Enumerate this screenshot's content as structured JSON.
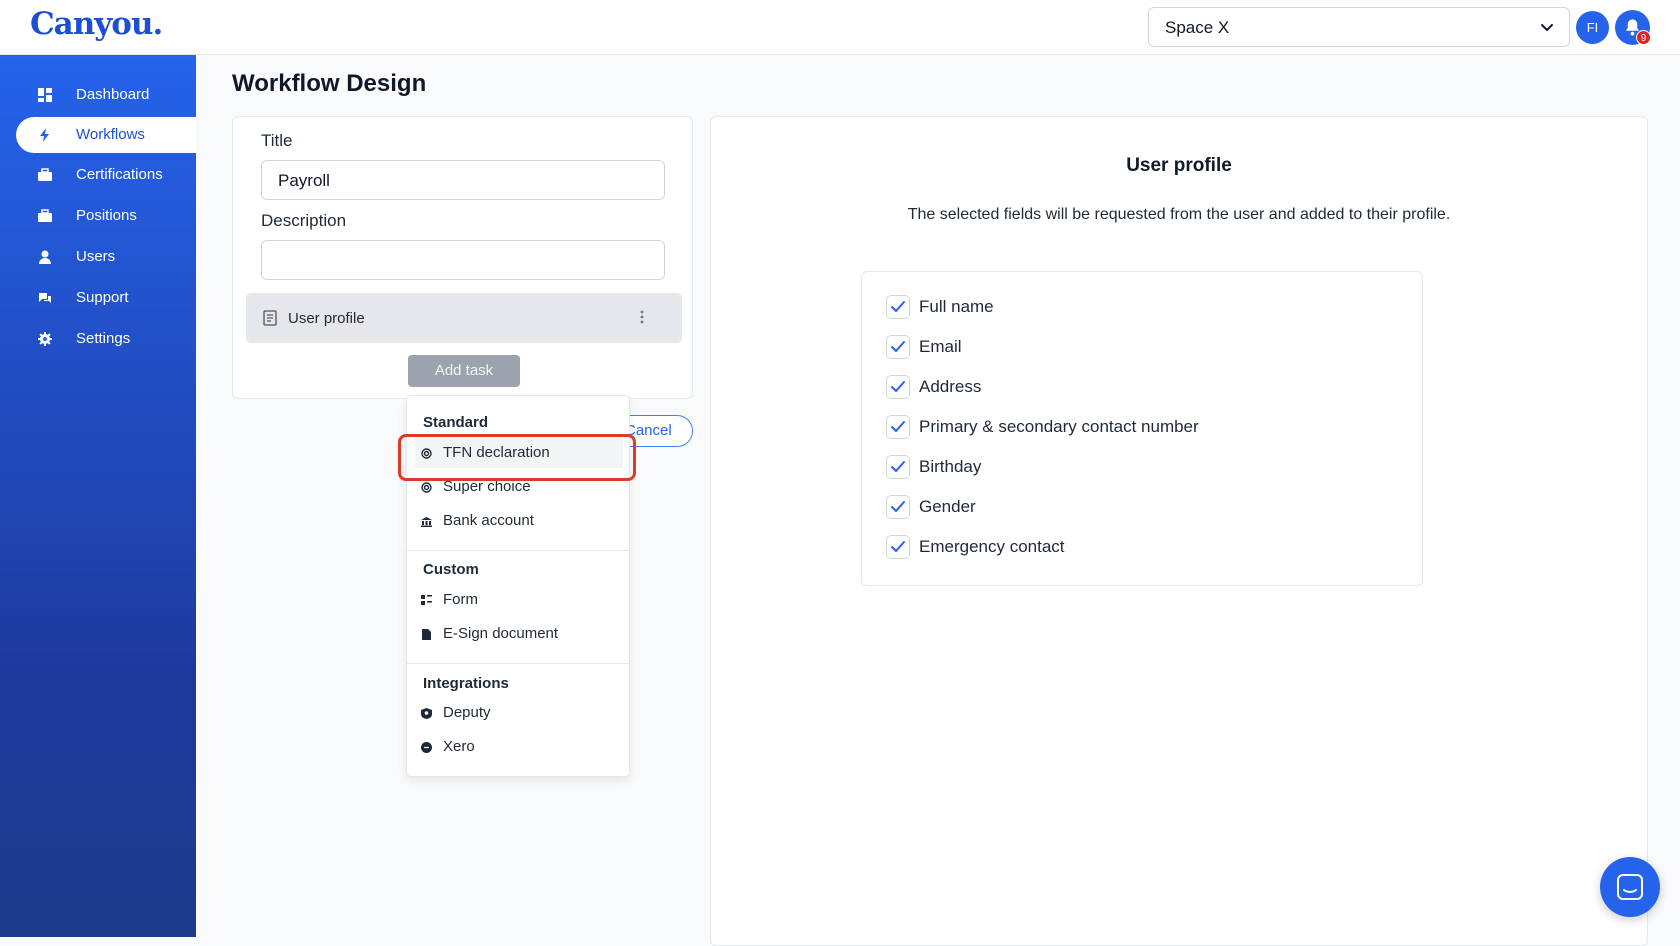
{
  "app": {
    "logo": "Canyou."
  },
  "header": {
    "space_selected": "Space X",
    "avatar_initials": "FI",
    "notification_count": "9"
  },
  "sidebar": {
    "items": [
      {
        "label": "Dashboard",
        "icon": "dashboard-icon"
      },
      {
        "label": "Workflows",
        "icon": "bolt-icon",
        "active": true
      },
      {
        "label": "Certifications",
        "icon": "briefcase-icon"
      },
      {
        "label": "Positions",
        "icon": "briefcase-icon"
      },
      {
        "label": "Users",
        "icon": "user-icon"
      },
      {
        "label": "Support",
        "icon": "support-icon"
      },
      {
        "label": "Settings",
        "icon": "gear-icon"
      }
    ]
  },
  "main": {
    "page_title": "Workflow Design",
    "form": {
      "title_label": "Title",
      "title_value": "Payroll",
      "description_label": "Description",
      "description_value": "",
      "task": {
        "label": "User profile"
      },
      "add_task_label": "Add task",
      "cancel_label": "Cancel"
    },
    "menu": {
      "groups": [
        {
          "heading": "Standard",
          "items": [
            "TFN declaration",
            "Super choice",
            "Bank account"
          ]
        },
        {
          "heading": "Custom",
          "items": [
            "Form",
            "E-Sign document"
          ]
        },
        {
          "heading": "Integrations",
          "items": [
            "Deputy",
            "Xero"
          ]
        }
      ],
      "highlighted_item": "TFN declaration"
    },
    "detail": {
      "title": "User profile",
      "description": "The selected fields will be requested from the user and added to their profile.",
      "fields": [
        {
          "label": "Full name",
          "checked": true
        },
        {
          "label": "Email",
          "checked": true
        },
        {
          "label": "Address",
          "checked": true
        },
        {
          "label": "Primary & secondary contact number",
          "checked": true
        },
        {
          "label": "Birthday",
          "checked": true
        },
        {
          "label": "Gender",
          "checked": true
        },
        {
          "label": "Emergency contact",
          "checked": true
        }
      ]
    }
  },
  "colors": {
    "primary": "#2563eb",
    "highlight": "#dc3b2a",
    "badge": "#dc2626"
  }
}
